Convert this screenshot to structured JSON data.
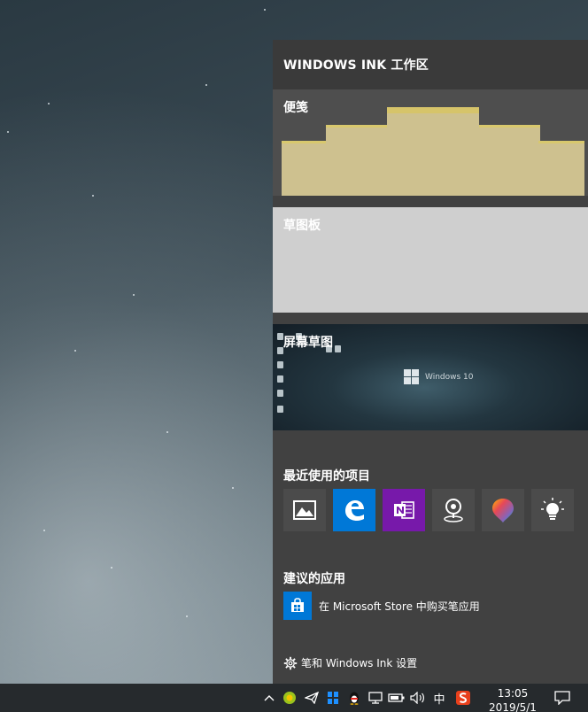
{
  "panel": {
    "title": "WINDOWS INK 工作区",
    "sticky_notes": {
      "label": "便笺"
    },
    "sketchpad": {
      "label": "草图板"
    },
    "screen_sketch": {
      "label": "屏幕草图",
      "preview_text": "Windows 10"
    },
    "recent": {
      "title": "最近使用的项目",
      "apps": [
        {
          "name": "photos",
          "icon": "photos-icon",
          "bg": "#4b4b4b"
        },
        {
          "name": "edge",
          "icon": "edge-icon",
          "bg": "#0078d7"
        },
        {
          "name": "onenote",
          "icon": "onenote-icon",
          "bg": "#7719aa"
        },
        {
          "name": "maps",
          "icon": "maps-icon",
          "bg": "#4b4b4b"
        },
        {
          "name": "paint-3d",
          "icon": "paint3d-icon",
          "bg": "#4b4b4b"
        },
        {
          "name": "tips",
          "icon": "tips-icon",
          "bg": "#4b4b4b"
        }
      ]
    },
    "suggested": {
      "title": "建议的应用",
      "store_text": "在 Microsoft Store 中购买笔应用"
    },
    "settings_text": "笔和 Windows Ink 设置"
  },
  "taskbar": {
    "ime": "中",
    "time": "13:05",
    "date": "2019/5/1"
  },
  "colors": {
    "panel_bg": "#414141",
    "header_bg": "#3a3a3a",
    "sticky_yellow": "#cec18f",
    "sketchpad_bg": "#cfcfcf",
    "accent_blue": "#0078d7",
    "onenote_purple": "#7719aa",
    "taskbar_bg": "#262a2d"
  }
}
